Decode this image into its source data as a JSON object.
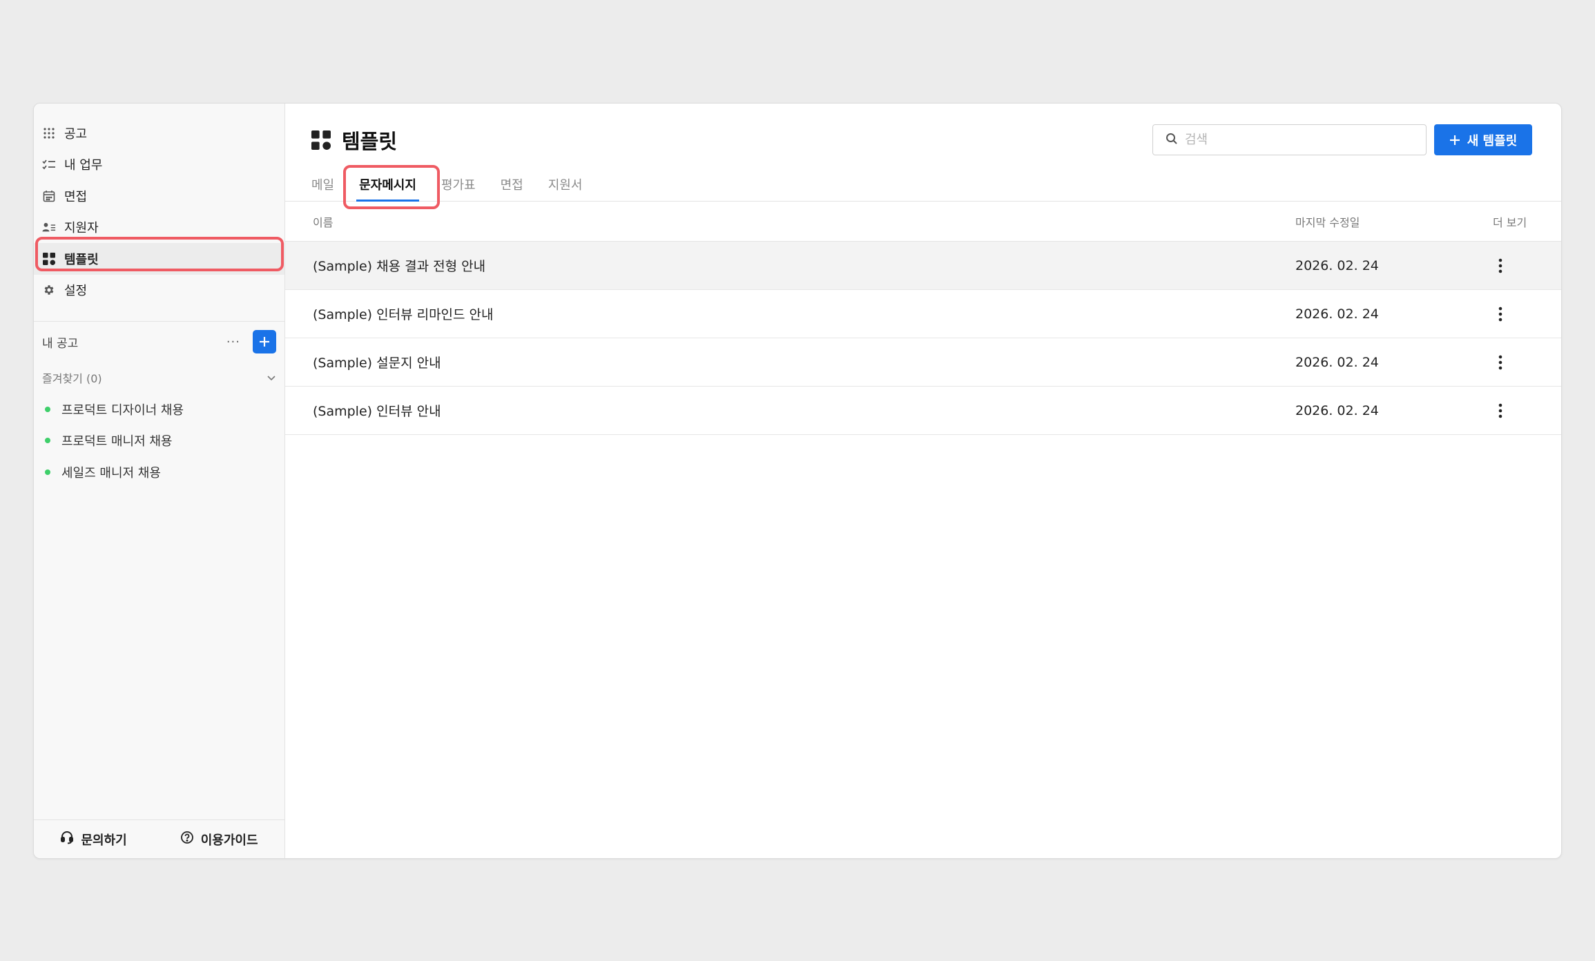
{
  "sidebar": {
    "nav": [
      {
        "label": "공고",
        "icon": "grid-dots-icon"
      },
      {
        "label": "내 업무",
        "icon": "checklist-icon"
      },
      {
        "label": "면접",
        "icon": "calendar-icon"
      },
      {
        "label": "지원자",
        "icon": "person-list-icon"
      },
      {
        "label": "템플릿",
        "icon": "template-grid-icon",
        "active": true
      },
      {
        "label": "설정",
        "icon": "gear-icon"
      }
    ],
    "my_posts_label": "내 공고",
    "more_label": "···",
    "favorites_label": "즐겨찾기 (0)",
    "favorites": [
      {
        "label": "프로덕트 디자이너 채용"
      },
      {
        "label": "프로덕트 매니저 채용"
      },
      {
        "label": "세일즈 매니저 채용"
      }
    ],
    "footer": {
      "contact_label": "문의하기",
      "guide_label": "이용가이드"
    }
  },
  "header": {
    "title": "템플릿",
    "search_placeholder": "검색",
    "new_button_label": "새 템플릿"
  },
  "tabs": [
    {
      "label": "메일"
    },
    {
      "label": "문자메시지",
      "active": true
    },
    {
      "label": "평가표"
    },
    {
      "label": "면접"
    },
    {
      "label": "지원서"
    }
  ],
  "table": {
    "columns": {
      "name": "이름",
      "modified": "마지막 수정일",
      "more": "더 보기"
    },
    "rows": [
      {
        "name": "(Sample) 채용 결과 전형 안내",
        "date": "2026. 02. 24"
      },
      {
        "name": "(Sample) 인터뷰 리마인드 안내",
        "date": "2026. 02. 24"
      },
      {
        "name": "(Sample) 설문지 안내",
        "date": "2026. 02. 24"
      },
      {
        "name": "(Sample) 인터뷰 안내",
        "date": "2026. 02. 24"
      }
    ]
  },
  "colors": {
    "accent": "#1a73e8",
    "highlight": "#ef5b63",
    "status_dot": "#3ecf6a"
  }
}
